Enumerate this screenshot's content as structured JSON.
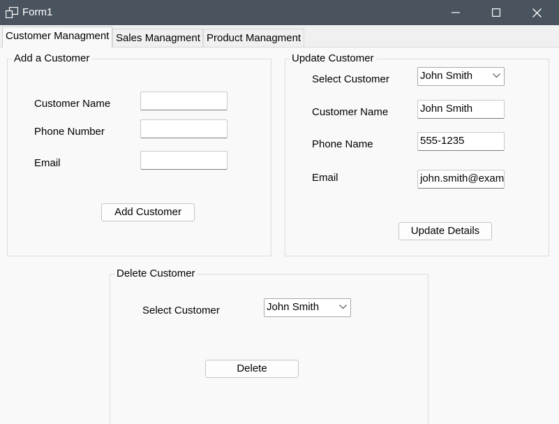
{
  "window": {
    "title": "Form1"
  },
  "tabs": [
    {
      "label": "Customer Managment"
    },
    {
      "label": "Sales Managment"
    },
    {
      "label": "Product Managment"
    }
  ],
  "add_customer": {
    "title": "Add a Customer",
    "name_label": "Customer Name",
    "phone_label": "Phone Number",
    "email_label": "Email",
    "name_value": "",
    "phone_value": "",
    "email_value": "",
    "button": "Add Customer"
  },
  "update_customer": {
    "title": "Update Customer",
    "select_label": "Select Customer",
    "select_value": "John Smith",
    "name_label": "Customer Name",
    "name_value": "John Smith",
    "phone_label": "Phone Name",
    "phone_value": "555-1235",
    "email_label": "Email",
    "email_value": "john.smith@exam",
    "button": "Update Details"
  },
  "delete_customer": {
    "title": "Delete Customer",
    "select_label": "Select Customer",
    "select_value": "John Smith",
    "button": "Delete"
  }
}
